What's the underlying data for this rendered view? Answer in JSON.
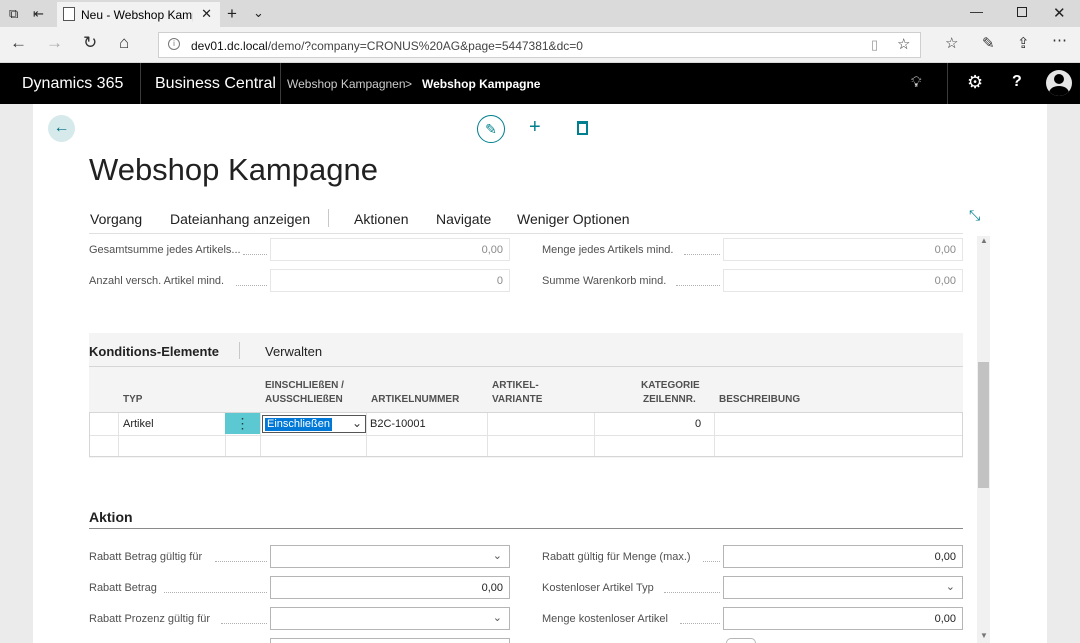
{
  "browser": {
    "tab_title": "Neu - Webshop Kampagne",
    "url_host": "dev01.dc.local",
    "url_path": "/demo/?company=CRONUS%20AG&page=5447381&dc=0"
  },
  "app": {
    "product": "Dynamics 365",
    "module": "Business Central",
    "breadcrumb_parent": "Webshop Kampagnen",
    "breadcrumb_separator": ">",
    "breadcrumb_current": "Webshop Kampagne"
  },
  "page": {
    "title": "Webshop Kampagne"
  },
  "actions": {
    "vorgang": "Vorgang",
    "dateianhang": "Dateianhang anzeigen",
    "aktionen": "Aktionen",
    "navigate": "Navigate",
    "weniger": "Weniger Optionen"
  },
  "conditions": {
    "gesamtsumme_label": "Gesamtsumme jedes Artikels...",
    "gesamtsumme_value": "0,00",
    "anzahl_label": "Anzahl versch. Artikel mind.",
    "anzahl_value": "0",
    "menge_label": "Menge jedes Artikels mind.",
    "menge_value": "0,00",
    "summe_label": "Summe Warenkorb mind.",
    "summe_value": "0,00"
  },
  "subpage": {
    "tab_title": "Konditions-Elemente",
    "tab_manage": "Verwalten",
    "columns": {
      "typ": "TYP",
      "einschl_1": "EINSCHLIEßEN /",
      "einschl_2": "AUSSCHLIEßEN",
      "artikelnummer": "ARTIKELNUMMER",
      "variante_1": "ARTIKEL-",
      "variante_2": "VARIANTE",
      "kategorie_1": "KATEGORIE",
      "kategorie_2": "ZEILENNR.",
      "beschreibung": "BESCHREIBUNG"
    },
    "row": {
      "typ": "Artikel",
      "einschl": "Einschließen",
      "artikelnummer": "B2C-10001",
      "variante": "",
      "kategorie": "0",
      "beschreibung": ""
    }
  },
  "aktion": {
    "title": "Aktion",
    "rabatt_betrag_gueltig_label": "Rabatt Betrag gültig für",
    "rabatt_betrag_gueltig_value": "",
    "rabatt_betrag_label": "Rabatt Betrag",
    "rabatt_betrag_value": "0,00",
    "rabatt_prozent_label": "Rabatt Prozenz gültig für",
    "rabatt_prozent_value": "",
    "rabatt_menge_label": "Rabatt gültig für Menge (max.)",
    "rabatt_menge_value": "0,00",
    "kostenlos_typ_label": "Kostenloser Artikel Typ",
    "kostenlos_typ_value": "",
    "menge_kostenlos_label": "Menge kostenloser Artikel",
    "menge_kostenlos_value": "0,00"
  },
  "colors": {
    "accent": "#00808e",
    "selected_cell": "#5cc8d2",
    "header_bg": "#000000"
  }
}
